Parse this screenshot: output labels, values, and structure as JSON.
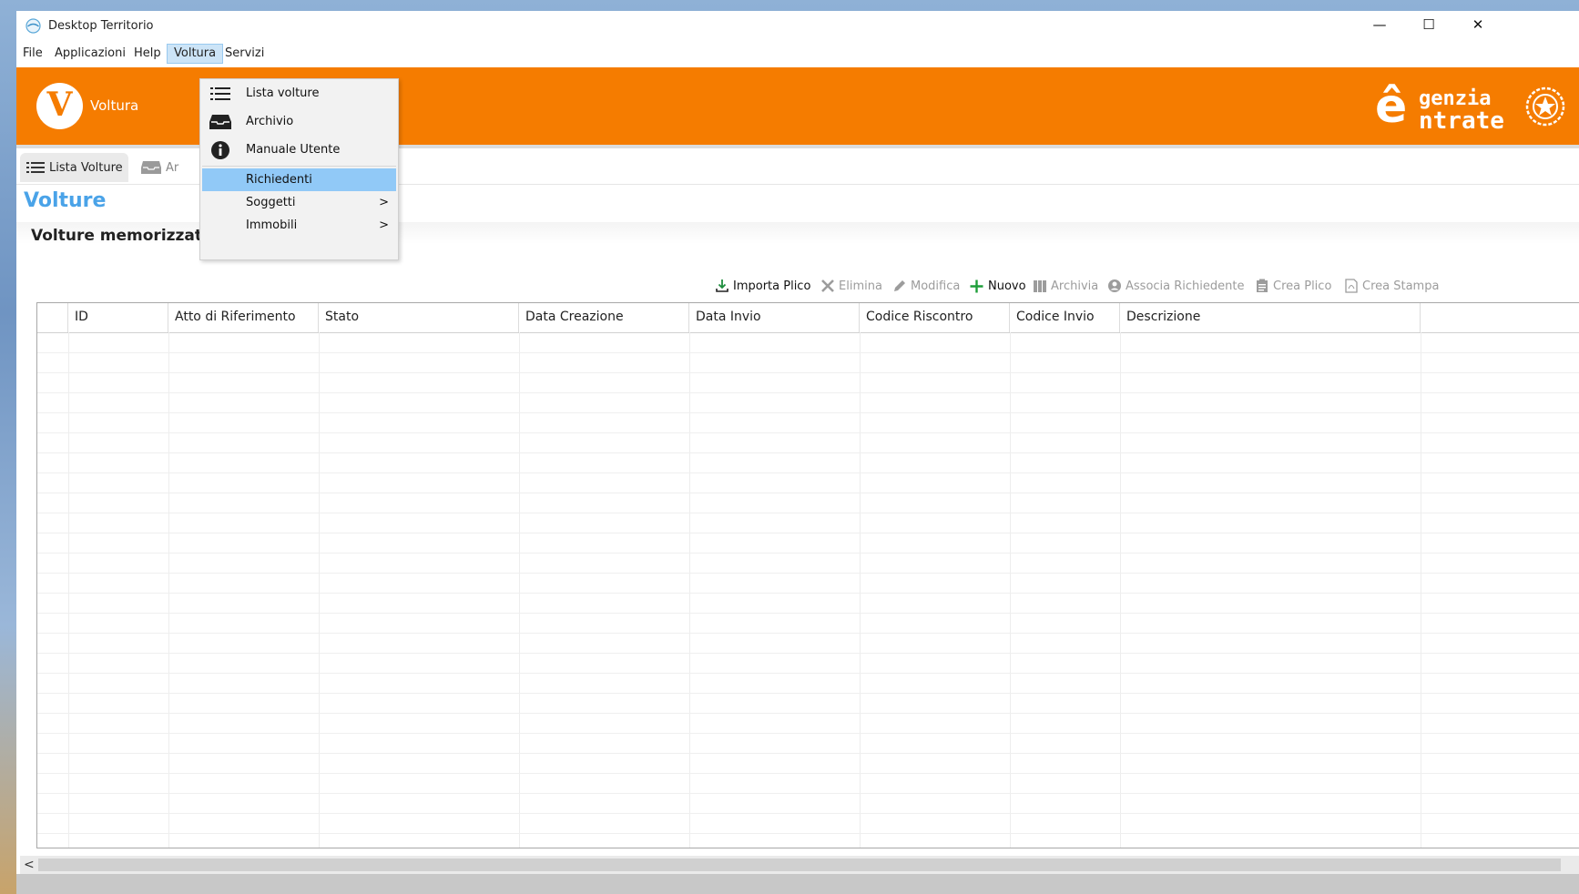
{
  "window": {
    "title": "Desktop Territorio",
    "controls": {
      "minimize": "—",
      "maximize": "☐",
      "close": "✕"
    }
  },
  "menubar": {
    "items": [
      {
        "label": "File"
      },
      {
        "label": "Applicazioni"
      },
      {
        "label": "Help"
      },
      {
        "label": "Voltura"
      },
      {
        "label": "Servizi"
      }
    ]
  },
  "banner": {
    "app_logo_letter": "V",
    "app_name": "Voltura",
    "brand_e_glyph": "ê",
    "brand_line1": "genzia",
    "brand_line2": "ntrate",
    "accent_color": "#f57c00"
  },
  "tabs": [
    {
      "label": "Lista Volture",
      "icon": "list-icon"
    },
    {
      "label": "Ar",
      "icon": "inbox-icon"
    }
  ],
  "page": {
    "title": "Volture",
    "subtitle": "Volture memorizzate"
  },
  "toolbar": {
    "import_label": "Importa Plico",
    "delete_label": "Elimina",
    "edit_label": "Modifica",
    "new_label": "Nuovo",
    "archive_label": "Archivia",
    "assoc_label": "Associa Richiedente",
    "create_label": "Crea Plico",
    "print_label": "Crea Stampa"
  },
  "table": {
    "columns": [
      "ID",
      "Atto di Riferimento",
      "Stato",
      "Data Creazione",
      "Data Invio",
      "Codice Riscontro",
      "Codice Invio",
      "Descrizione"
    ],
    "rows": []
  },
  "dropdown": {
    "items": [
      {
        "label": "Lista volture",
        "icon": "list-icon"
      },
      {
        "label": "Archivio",
        "icon": "inbox-icon"
      },
      {
        "label": "Manuale Utente",
        "icon": "info-icon"
      },
      {
        "label": "Richiedenti",
        "icon": ""
      },
      {
        "label": "Soggetti",
        "icon": "",
        "submenu": ">"
      },
      {
        "label": "Immobili",
        "icon": "",
        "submenu": ">"
      }
    ]
  },
  "scrollbar": {
    "left_arrow": "<"
  }
}
